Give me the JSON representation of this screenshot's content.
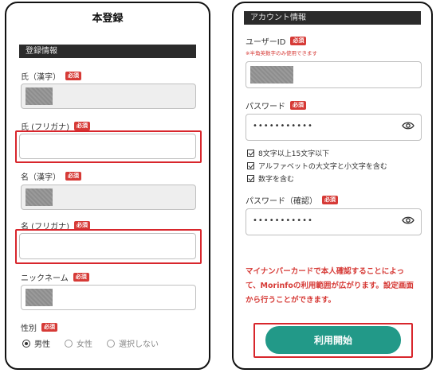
{
  "registration": {
    "title": "本登録",
    "section_label": "登録情報",
    "required_badge": "必須",
    "last_name_kanji_label": "氏（漢字）",
    "last_name_kana_label": "氏 (フリガナ)",
    "first_name_kanji_label": "名（漢字）",
    "first_name_kana_label": "名 (フリガナ)",
    "nickname_label": "ニックネーム",
    "gender_label": "性別",
    "gender_options": [
      "男性",
      "女性",
      "選択しない"
    ],
    "gender_selected": "男性"
  },
  "account": {
    "section_label": "アカウント情報",
    "user_id_label": "ユーザーID",
    "user_id_hint": "※半角英数字のみ使用できます",
    "password_label": "パスワード",
    "password_value": "•••••••••••",
    "password_rules": [
      "8文字以上15文字以下",
      "アルファベットの大文字と小文字を含む",
      "数字を含む"
    ],
    "password_confirm_label": "パスワード（確認）",
    "password_confirm_value": "•••••••••••",
    "notice_lines": [
      "マイナンバーカードで本人確認することによっ",
      "て、Morinfoの利用範囲が広がります。設定画面",
      "から行うことができます。"
    ],
    "start_button_label": "利用開始"
  },
  "colors": {
    "accent_teal": "#229988",
    "required_red": "#d63a36",
    "highlight_red": "#d8262c",
    "section_bar": "#2b2b2b"
  }
}
